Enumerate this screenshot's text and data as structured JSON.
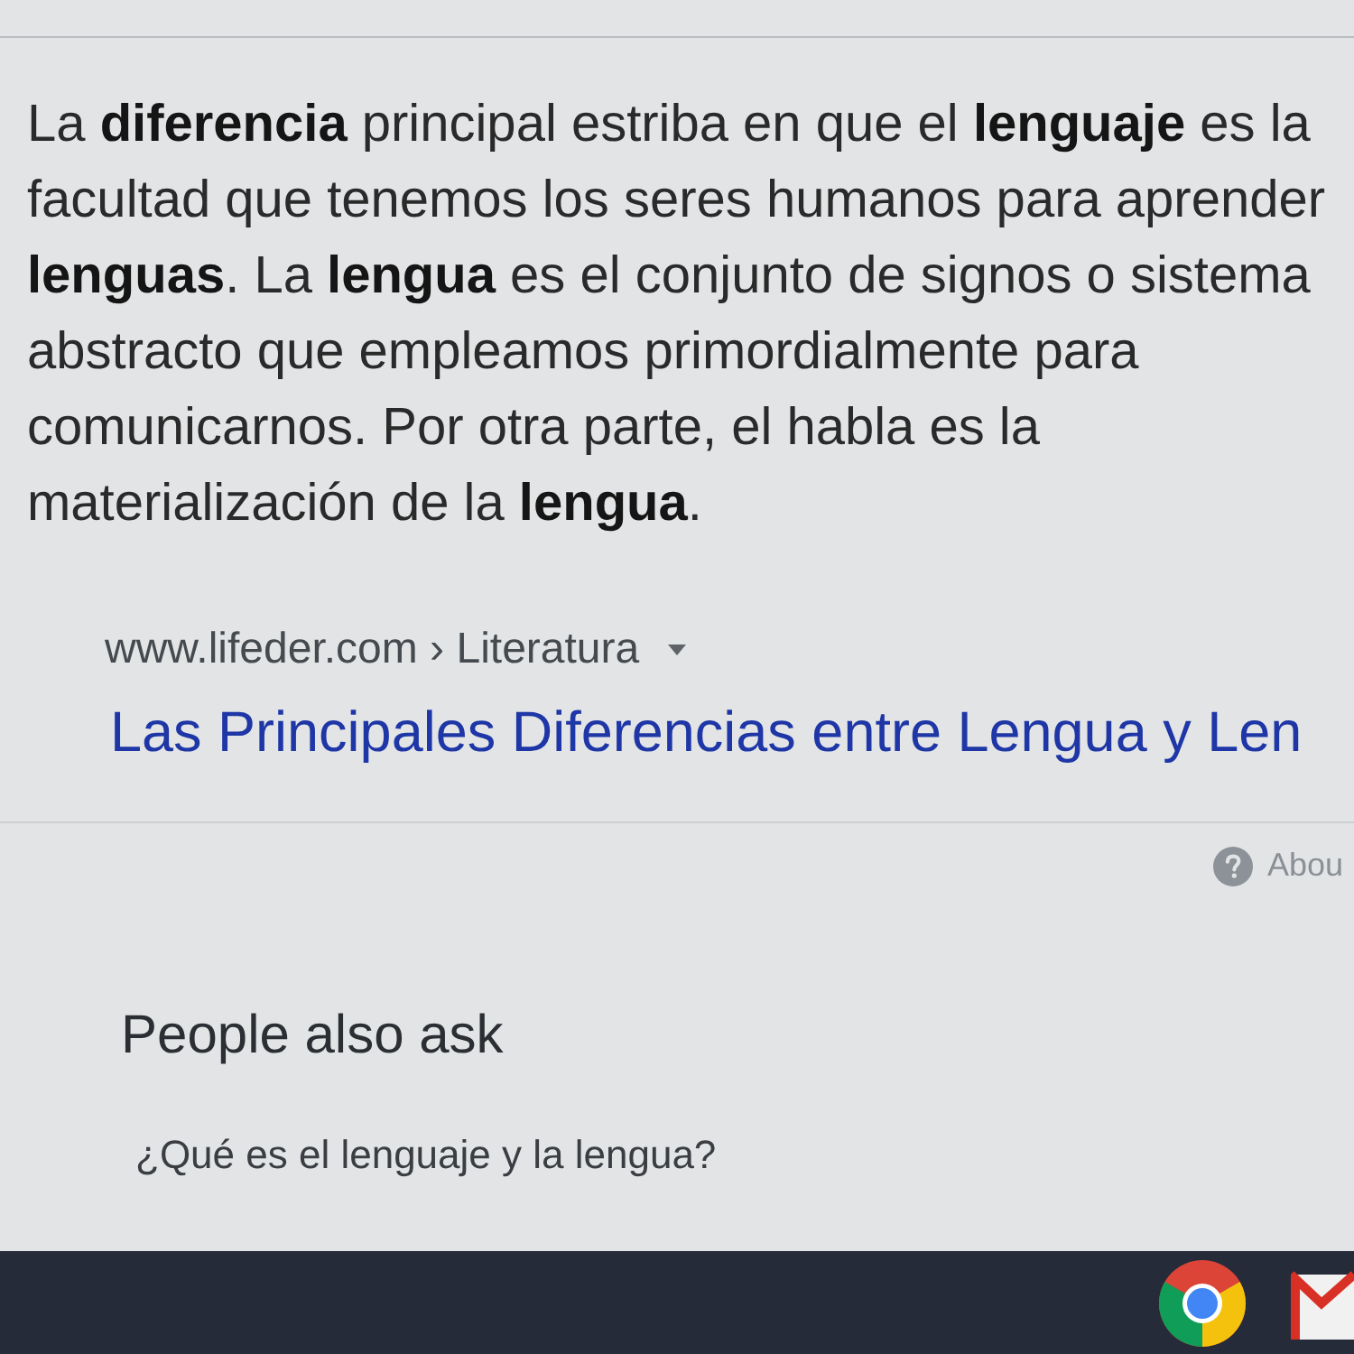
{
  "snippet": {
    "text": "La **diferencia** principal estriba en que el **lenguaje** es la facultad que tenemos los seres humanos para aprender **lenguas**. La **lengua** es el conjunto de signos o sistema abstracto que empleamos primordialmente para comunicarnos. Por otra parte, el habla es la materialización de la **lengua**.",
    "breadcrumb": "www.lifeder.com › Literatura",
    "title": "Las Principales Diferencias entre Lengua y Len"
  },
  "about": {
    "label": "Abou"
  },
  "people_also_ask": {
    "heading": "People also ask",
    "questions": [
      "¿Qué es el lenguaje y la lengua?"
    ]
  },
  "taskbar": {
    "apps": [
      {
        "kind": "chrome"
      },
      {
        "kind": "mail"
      }
    ]
  }
}
